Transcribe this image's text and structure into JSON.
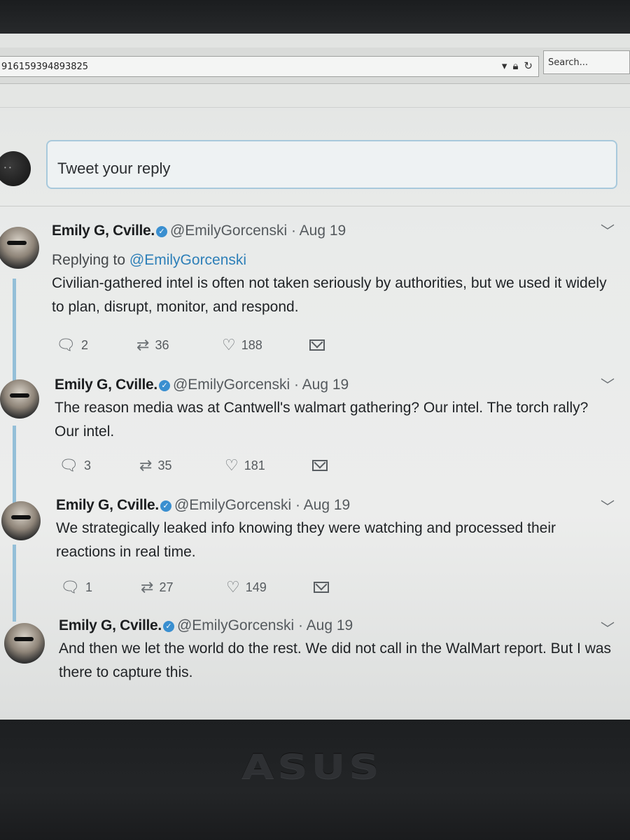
{
  "browser": {
    "url_fragment": "916159394893825",
    "search_placeholder": "Search..."
  },
  "composer": {
    "placeholder": "Tweet your reply"
  },
  "tweets": [
    {
      "name": "Emily G, Cville.",
      "handle": "@EmilyGorcenski",
      "separator": "·",
      "date": "Aug 19",
      "replying_prefix": "Replying to",
      "replying_to": "@EmilyGorcenski",
      "text": "Civilian-gathered intel is often not taken seriously by authorities, but we used it widely to plan, disrupt, monitor, and respond.",
      "replies": "2",
      "retweets": "36",
      "likes": "188"
    },
    {
      "name": "Emily G, Cville.",
      "handle": "@EmilyGorcenski",
      "separator": "·",
      "date": "Aug 19",
      "text": "The reason media was at Cantwell's walmart gathering? Our intel. The torch rally? Our intel.",
      "replies": "3",
      "retweets": "35",
      "likes": "181"
    },
    {
      "name": "Emily G, Cville.",
      "handle": "@EmilyGorcenski",
      "separator": "·",
      "date": "Aug 19",
      "text": "We strategically leaked info knowing they were watching and processed their reactions in real time.",
      "replies": "1",
      "retweets": "27",
      "likes": "149"
    },
    {
      "name": "Emily G, Cville.",
      "handle": "@EmilyGorcenski",
      "separator": "·",
      "date": "Aug 19",
      "text": "And then we let the world do the rest. We did not call in the WalMart report. But I was there to capture this."
    }
  ],
  "monitor": {
    "brand": "ASUS"
  },
  "colors": {
    "link": "#2d7fb8",
    "verified": "#3a8fd0",
    "thread_line": "#94bfd8"
  }
}
